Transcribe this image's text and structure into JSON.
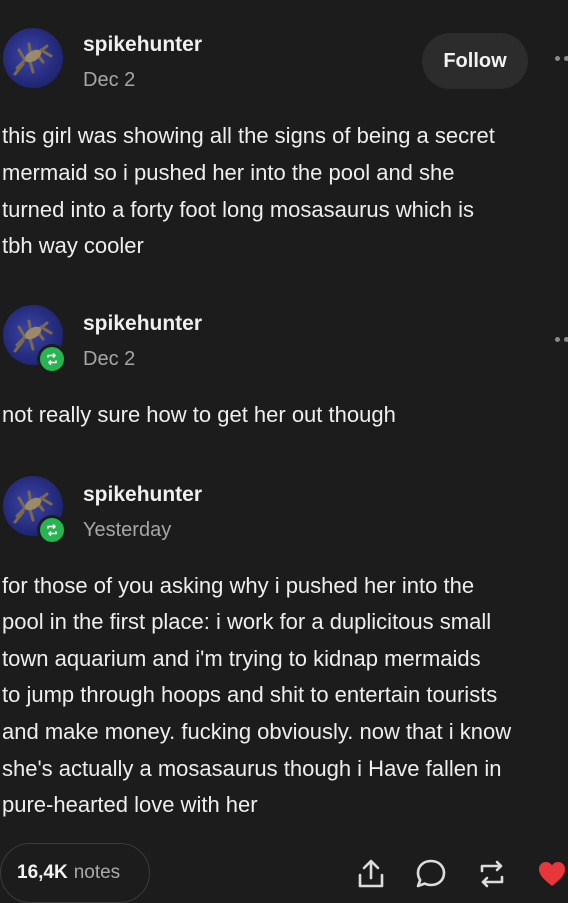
{
  "posts": [
    {
      "username": "spikehunter",
      "date": "Dec 2",
      "follow_label": "Follow",
      "text_lines": [
        "this girl was showing all the signs of being a secret",
        "mermaid so i pushed her into the pool and she",
        "turned into a forty foot long mosasaurus which is",
        "tbh way cooler"
      ]
    },
    {
      "username": "spikehunter",
      "date": "Dec 2",
      "text_lines": [
        "not really sure how to get her out though"
      ]
    },
    {
      "username": "spikehunter",
      "date": "Yesterday",
      "text_lines": [
        "for those of you asking why i pushed her into the",
        "pool in the first place: i work for a duplicitous small",
        "town aquarium and i'm trying to kidnap mermaids",
        "to jump through hoops and shit to entertain tourists",
        "and make money. fucking obviously. now that i know",
        "she's actually a mosasaurus though i Have fallen in",
        "pure-hearted love with her"
      ]
    }
  ],
  "footer": {
    "notes_count": "16,4K",
    "notes_label": "notes"
  },
  "colors": {
    "background": "#1c1c1c",
    "reblog_green": "#27b552",
    "like_red": "#e9363b"
  },
  "icons": [
    "share-icon",
    "comment-icon",
    "reblog-icon",
    "heart-icon",
    "more-dots-icon"
  ]
}
